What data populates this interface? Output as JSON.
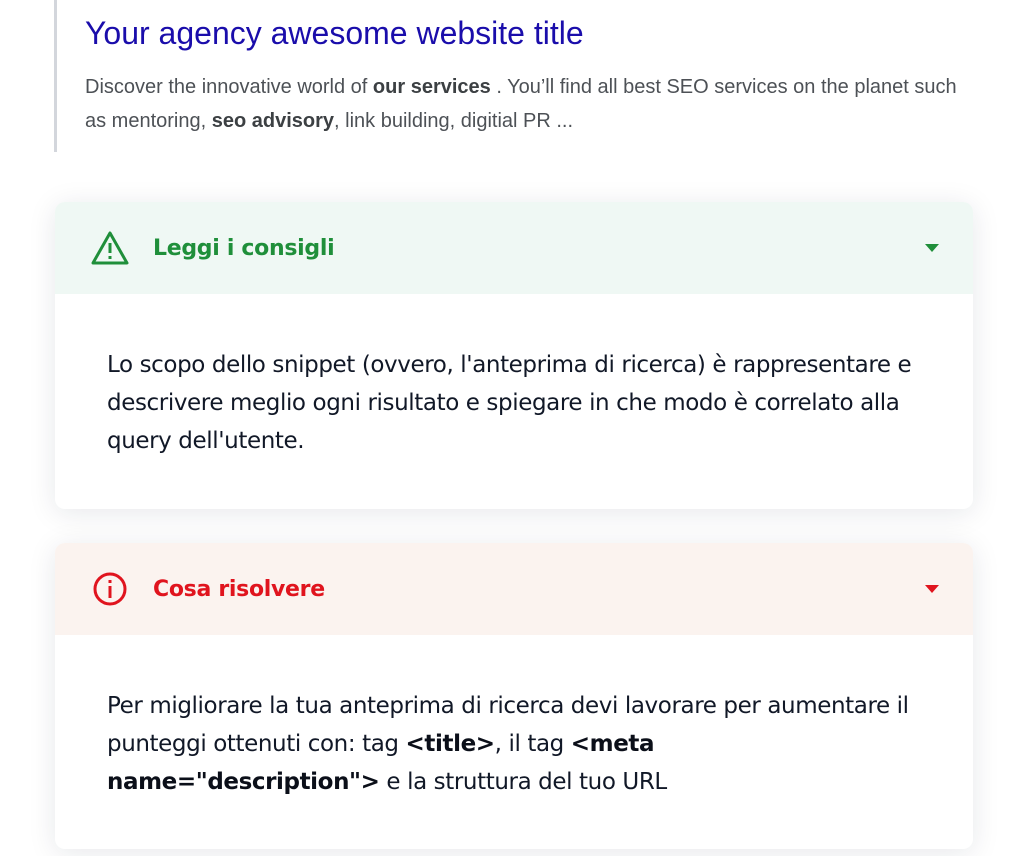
{
  "serp": {
    "title": "Your agency awesome website title",
    "description": {
      "part1": "Discover the innovative world of ",
      "bold1": "our services",
      "part2": " . You’ll find all best SEO services on the planet such as mentoring, ",
      "bold2": "seo advisory",
      "part3": ", link building, digitial PR ..."
    },
    "title_color": "#1a0dab"
  },
  "tips_card": {
    "label": "Leggi i consigli",
    "icon": "warning-triangle-icon",
    "accent": "#1f8f3a",
    "body": "Lo scopo dello snippet (ovvero, l'anteprima di ricerca) è rappresentare e descrivere meglio ogni risultato e spiegare in che modo è correlato alla query dell'utente."
  },
  "fix_card": {
    "label": "Cosa risolvere",
    "icon": "info-circle-icon",
    "accent": "#e0141e",
    "body": {
      "part1": "Per migliorare la tua anteprima di ricerca devi lavorare per aumentare il punteggi ottenuti con: tag ",
      "bold1": "<title>",
      "part2": ", il tag ",
      "bold2": "<meta name=\"description\">",
      "part3": " e la struttura del tuo URL"
    }
  }
}
